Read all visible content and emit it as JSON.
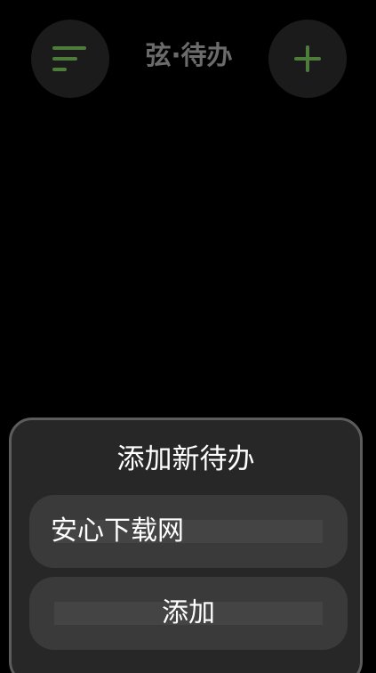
{
  "header": {
    "title": "弦·待办",
    "menu_icon": "filter-menu-icon",
    "add_icon": "plus-icon",
    "accent_color": "#4e7c3a"
  },
  "add_sheet": {
    "title": "添加新待办",
    "input_value": "安心下载网",
    "submit_label": "添加"
  }
}
